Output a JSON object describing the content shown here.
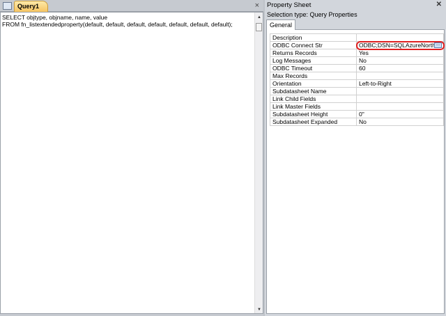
{
  "query_tab": {
    "title": "Query1",
    "close": "×"
  },
  "sql": {
    "lines": [
      "SELECT objtype, objname, name, value",
      "FROM fn_listextendedproperty(default, default, default, default, default, default, default);"
    ]
  },
  "property_sheet": {
    "title": "Property Sheet",
    "close": "✕",
    "selection_type": "Selection type:  Query Properties",
    "tab": "General",
    "rows": [
      {
        "name": "Description",
        "value": ""
      },
      {
        "name": "ODBC Connect Str",
        "value": "ODBC;DSN=SQLAzureNorthw"
      },
      {
        "name": "Returns Records",
        "value": "Yes"
      },
      {
        "name": "Log Messages",
        "value": "No"
      },
      {
        "name": "ODBC Timeout",
        "value": "60"
      },
      {
        "name": "Max Records",
        "value": ""
      },
      {
        "name": "Orientation",
        "value": "Left-to-Right"
      },
      {
        "name": "Subdatasheet Name",
        "value": ""
      },
      {
        "name": "Link Child Fields",
        "value": ""
      },
      {
        "name": "Link Master Fields",
        "value": ""
      },
      {
        "name": "Subdatasheet Height",
        "value": "0\""
      },
      {
        "name": "Subdatasheet Expanded",
        "value": "No"
      }
    ],
    "builder_label": "..."
  }
}
